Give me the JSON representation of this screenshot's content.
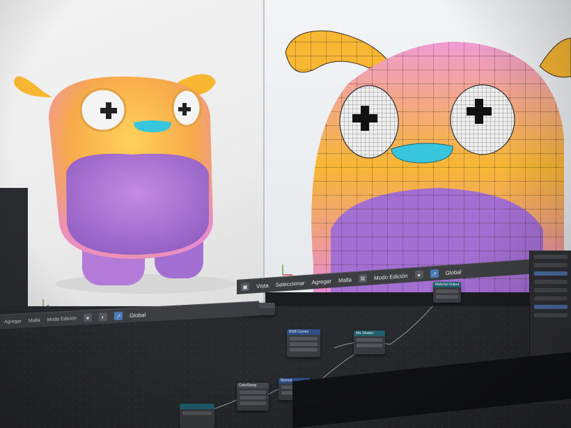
{
  "left_viewport": {
    "header": {
      "items": [
        "Agregar",
        "Malla",
        "Modo Edición"
      ]
    }
  },
  "right_viewport": {
    "header": {
      "global_label": "Global",
      "menu_items": [
        "Vista",
        "Seleccionar",
        "Agregar",
        "Malla"
      ],
      "mode_label": "Modo Edición"
    },
    "coord_label": "Global"
  },
  "node_editor": {
    "nodes": [
      {
        "title": "Normal"
      },
      {
        "title": "RGB Curves"
      },
      {
        "title": "Mix Shader"
      },
      {
        "title": "Material Output"
      },
      {
        "title": "Normal"
      },
      {
        "title": "ColorRamp"
      }
    ]
  },
  "colors": {
    "character_yellow": "#f7b733",
    "character_pink": "#e98bd0",
    "belly_purple": "#a46fd3",
    "mouth_cyan": "#38c6de",
    "ui_dark": "#28292c",
    "ui_header": "#3d3e42",
    "accent_blue": "#4a79b8"
  }
}
